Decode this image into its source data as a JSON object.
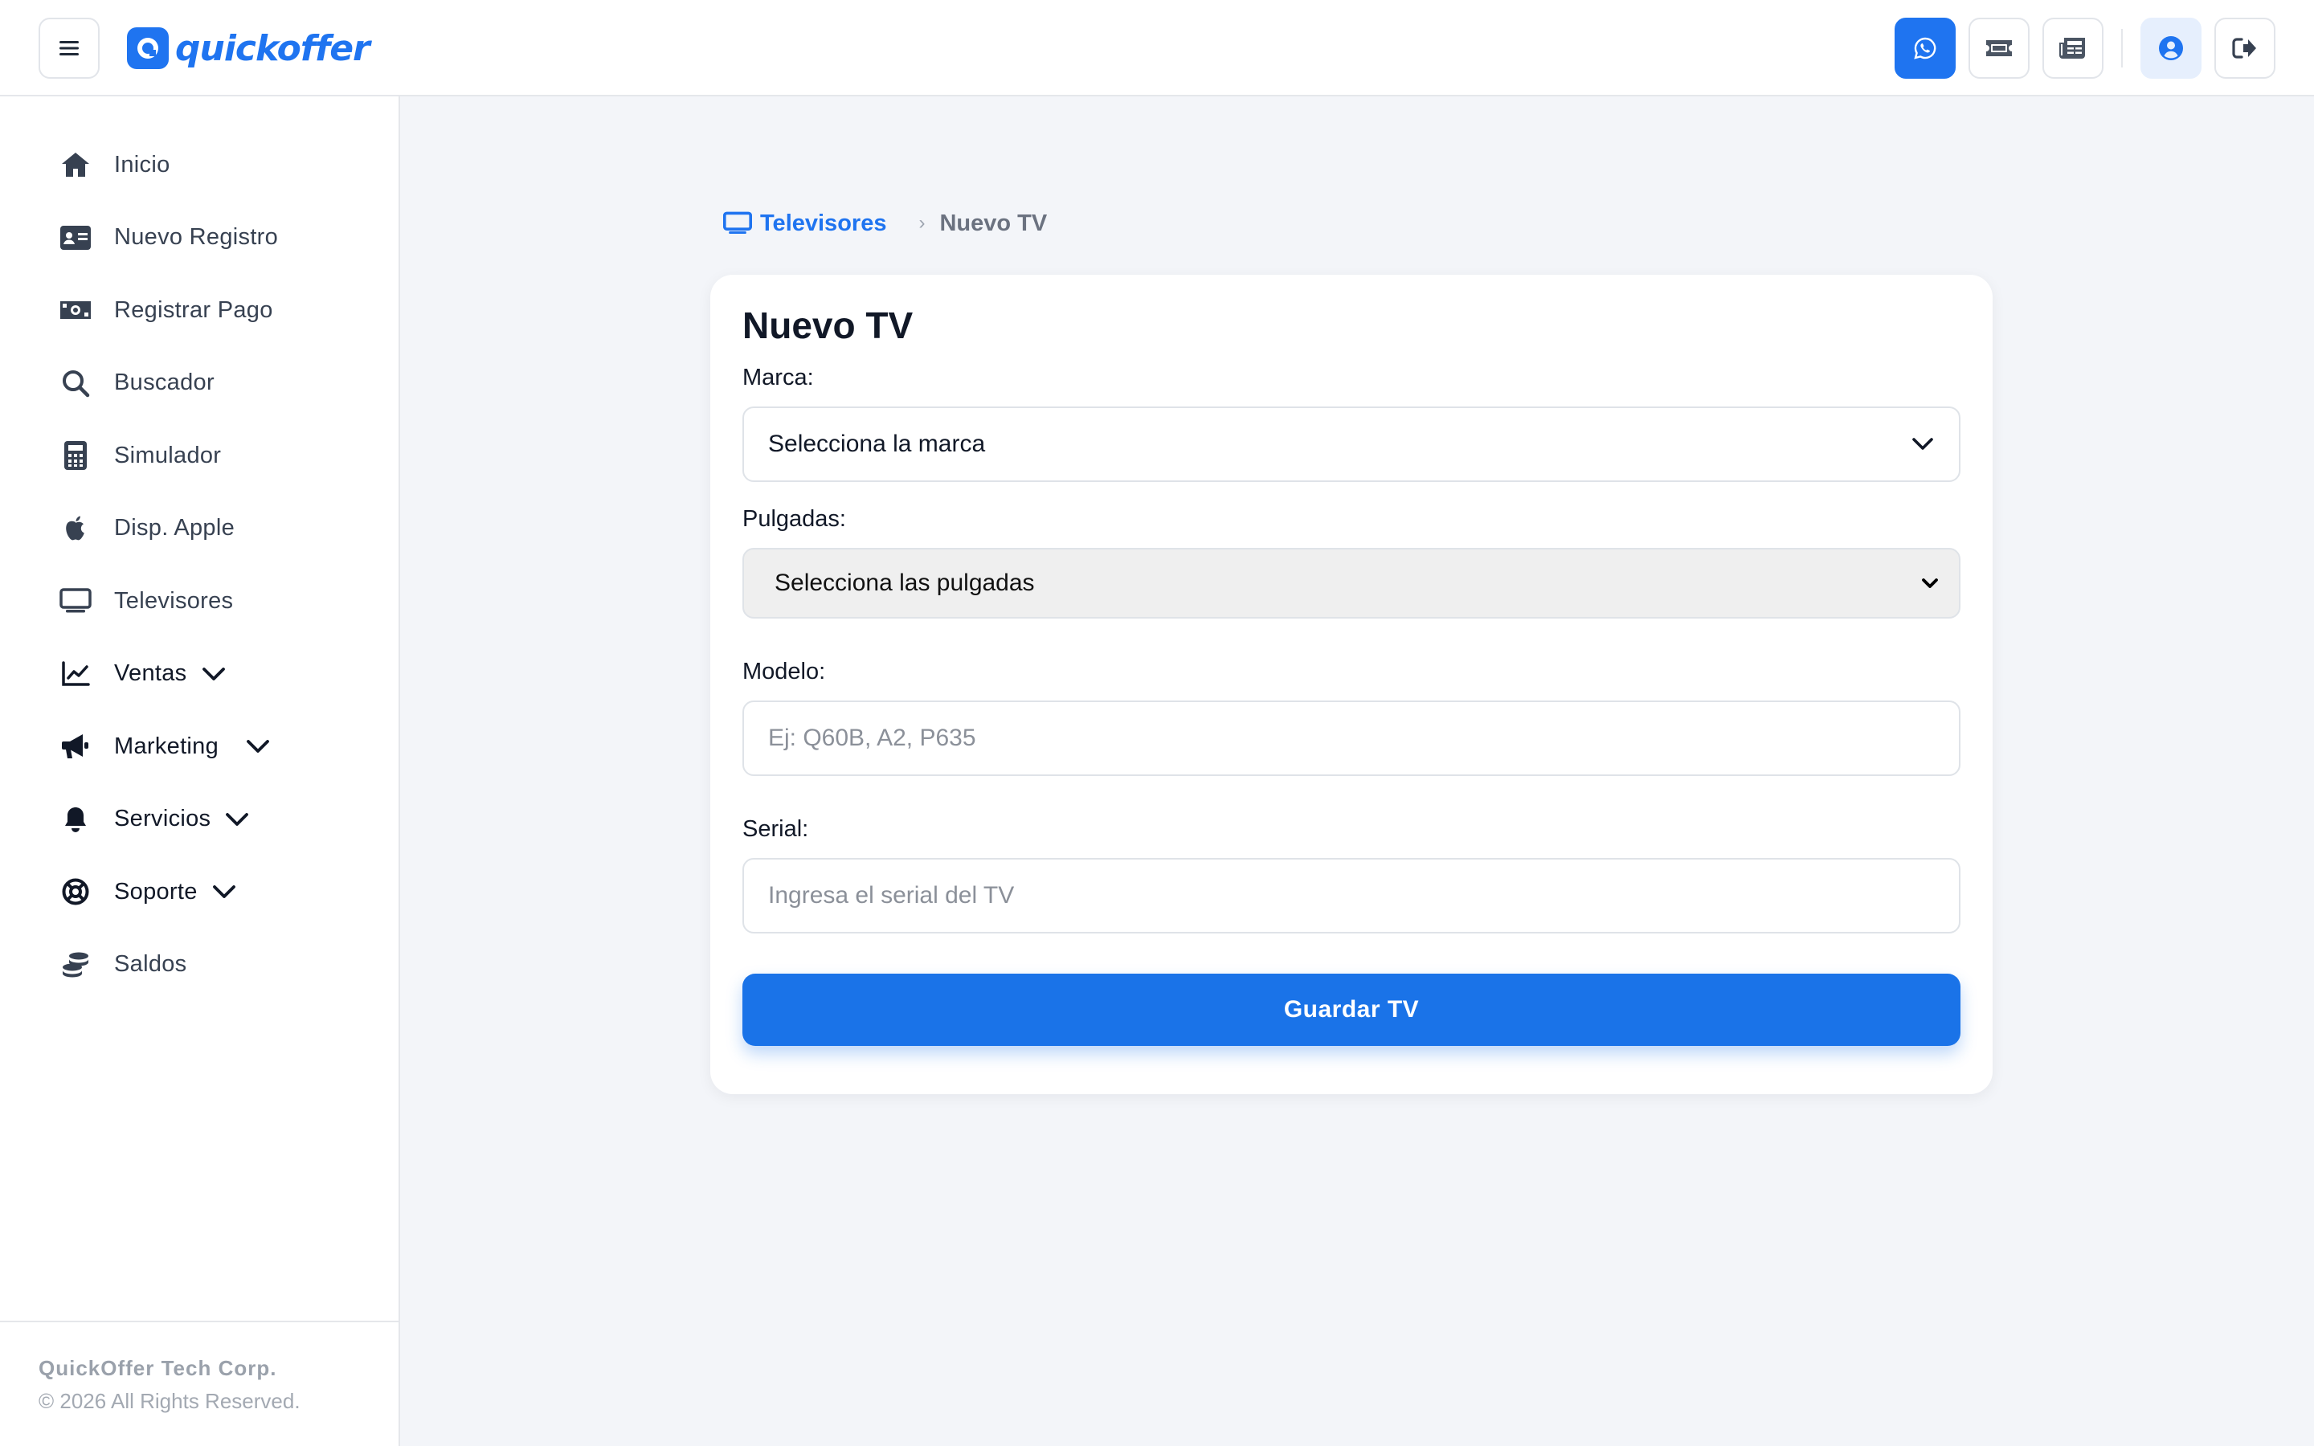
{
  "header": {
    "brand_name": "quickoffer",
    "actions": [
      {
        "icon": "whatsapp-icon"
      },
      {
        "icon": "ticket-icon"
      },
      {
        "icon": "newspaper-icon"
      },
      {
        "icon": "user-circle-icon"
      },
      {
        "icon": "sign-out-icon"
      }
    ]
  },
  "sidebar": {
    "items": [
      {
        "label": "Inicio",
        "icon": "home-icon"
      },
      {
        "label": "Nuevo Registro",
        "icon": "id-card-icon"
      },
      {
        "label": "Registrar Pago",
        "icon": "money-bill-icon"
      },
      {
        "label": "Buscador",
        "icon": "search-icon"
      },
      {
        "label": "Simulador",
        "icon": "calculator-icon"
      },
      {
        "label": "Disp. Apple",
        "icon": "apple-icon"
      },
      {
        "label": "Televisores",
        "icon": "tv-icon"
      },
      {
        "label": "Ventas",
        "icon": "chart-line-icon",
        "expandable": true
      },
      {
        "label": "Marketing",
        "icon": "bullhorn-icon",
        "expandable": true
      },
      {
        "label": "Servicios",
        "icon": "bell-icon",
        "expandable": true
      },
      {
        "label": "Soporte",
        "icon": "life-ring-icon",
        "expandable": true
      },
      {
        "label": "Saldos",
        "icon": "coins-icon"
      }
    ],
    "footer": {
      "company": "QuickOffer Tech Corp.",
      "copyright": "© 2026 All Rights Reserved."
    }
  },
  "breadcrumb": {
    "parent": "Televisores",
    "current": "Nuevo TV"
  },
  "form": {
    "title": "Nuevo TV",
    "brand_label": "Marca:",
    "brand_value": "Selecciona la marca",
    "inches_label": "Pulgadas:",
    "inches_value": "Selecciona las pulgadas",
    "model_label": "Modelo:",
    "model_placeholder": "Ej: Q60B, A2, P635",
    "serial_label": "Serial:",
    "serial_placeholder": "Ingresa el serial del TV",
    "submit_label": "Guardar TV"
  },
  "colors": {
    "primary": "#1f74f0",
    "background": "#f3f5f9",
    "sidebar_text": "#374151"
  }
}
